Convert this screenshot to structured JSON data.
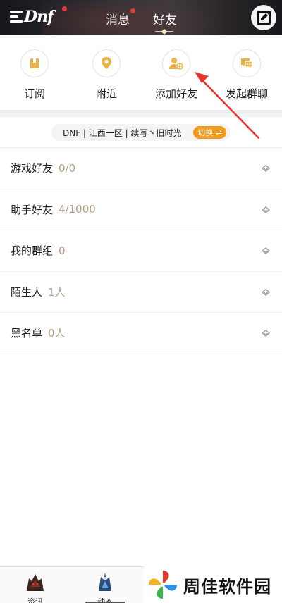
{
  "header": {
    "logo_text": "Dnf",
    "tabs": [
      {
        "label": "消息",
        "has_dot": true
      },
      {
        "label": "好友",
        "active": true
      }
    ]
  },
  "quick_actions": [
    {
      "label": "订阅",
      "icon": "bookmark-icon"
    },
    {
      "label": "附近",
      "icon": "location-pin-icon"
    },
    {
      "label": "添加好友",
      "icon": "add-friend-icon"
    },
    {
      "label": "发起群聊",
      "icon": "group-chat-icon"
    }
  ],
  "server": {
    "text": "DNF | 江西一区 | 续写丶旧时光",
    "switch_label": "切换 ⇌"
  },
  "friend_groups": [
    {
      "name": "游戏好友",
      "count": "0/0"
    },
    {
      "name": "助手好友",
      "count": "4/1000"
    },
    {
      "name": "我的群组",
      "count": "0"
    },
    {
      "name": "陌生人",
      "count": "1人"
    },
    {
      "name": "黑名单",
      "count": "0人"
    }
  ],
  "bottom_nav": [
    {
      "label": "资讯"
    },
    {
      "label": "动态",
      "active": true
    }
  ],
  "watermark": {
    "text": "周佳软件园"
  },
  "colors": {
    "accent_orange": "#f29a1c",
    "icon_gold": "#e9b24a",
    "count_tan": "#b39e84",
    "annotation_red": "#e8342d",
    "header_dark": "#1e2026"
  }
}
